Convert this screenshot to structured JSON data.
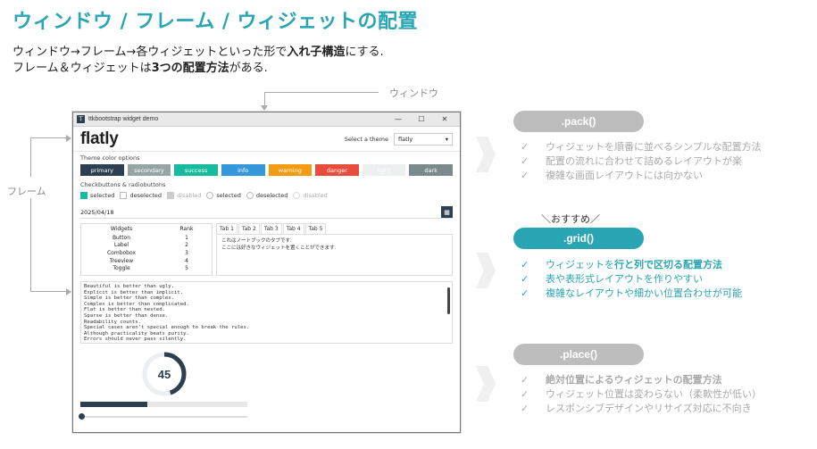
{
  "slide": {
    "title": "ウィンドウ / フレーム / ウィジェットの配置",
    "intro_line1_a": "ウィンドウ→フレーム→各ウィジェットといった形で",
    "intro_line1_b": "入れ子構造",
    "intro_line1_c": "にする.",
    "intro_line2_a": "フレーム＆ウィジェットは",
    "intro_line2_b": "3つの配置方法",
    "intro_line2_c": "がある.",
    "label_window": "ウィンドウ",
    "label_frame": "フレーム"
  },
  "app": {
    "window_title": "ttkbootstrap widget demo",
    "win_controls": [
      "—",
      "☐",
      "✕"
    ],
    "brand": "flatly",
    "theme_label": "Select a theme",
    "theme_value": "flatly",
    "theme_color_group": "Theme color options",
    "color_buttons": [
      {
        "label": "primary",
        "color": "#2c3e50",
        "text": "#ffffff"
      },
      {
        "label": "secondary",
        "color": "#95a5a6",
        "text": "#ffffff"
      },
      {
        "label": "success",
        "color": "#18bc9c",
        "text": "#ffffff"
      },
      {
        "label": "info",
        "color": "#3498db",
        "text": "#ffffff"
      },
      {
        "label": "warning",
        "color": "#f39c12",
        "text": "#ffffff"
      },
      {
        "label": "danger",
        "color": "#e74c3c",
        "text": "#ffffff"
      },
      {
        "label": "light",
        "color": "#ecf0f1",
        "text": "#ffffff"
      },
      {
        "label": "dark",
        "color": "#7b8a8b",
        "text": "#ffffff"
      }
    ],
    "check_group": "Checkbuttons & radiobuttons",
    "checks": {
      "selected": "selected",
      "deselected": "deselected",
      "disabled": "disabled"
    },
    "radios": {
      "selected": "selected",
      "deselected": "deselected",
      "disabled": "disabled"
    },
    "date": "2025/04/18",
    "tree": {
      "headers": [
        "Widgets",
        "Rank"
      ],
      "rows": [
        [
          "Button",
          "1"
        ],
        [
          "Label",
          "2"
        ],
        [
          "Combobox",
          "3"
        ],
        [
          "Treeview",
          "4"
        ],
        [
          "Toggle",
          "5"
        ]
      ]
    },
    "tabs": [
      "Tab 1",
      "Tab 2",
      "Tab 3",
      "Tab 4",
      "Tab 5"
    ],
    "notebook_text_1": "これはノートブックのタブです.",
    "notebook_text_2": "ここには好きなウィジェットを置くことができます.",
    "zen_lines": [
      "Beautiful is better than ugly.",
      "Explicit is better than implicit.",
      "Simple is better than complex.",
      "Complex is better than complicated.",
      "Flat is better than nested.",
      "Sparse is better than dense.",
      "Readability counts.",
      "Special cases aren't special enough to break the rules.",
      "Although practicality beats purity.",
      "Errors should never pass silently."
    ],
    "meter_value": "45",
    "meter_fraction": 0.45,
    "progress_fraction": 0.4,
    "scale_fraction": 0.01
  },
  "methods": {
    "pack": {
      "label": ".pack()",
      "points": [
        "ウィジェットを順番に並べるシンプルな配置方法",
        "配置の流れに合わせて詰めるレイアウトが楽",
        "複雑な画面レイアウトには向かない"
      ]
    },
    "recommend": "＼おすすめ／",
    "grid": {
      "label": ".grid()",
      "p1_a": "ウィジェットを",
      "p1_b": "行と列で区切る配置方法",
      "p2": "表や表形式レイアウトを作りやすい",
      "p3": "複雑なレイアウトや細かい位置合わせが可能"
    },
    "place": {
      "label": ".place()",
      "p1_a": "絶対位置による",
      "p1_b": "ウィジェットの配置方法",
      "p2": "ウィジェット位置は変わらない（柔軟性が低い）",
      "p3": "レスポンシブデザインやリサイズ対応に不向き"
    },
    "check_mark": "✓"
  }
}
